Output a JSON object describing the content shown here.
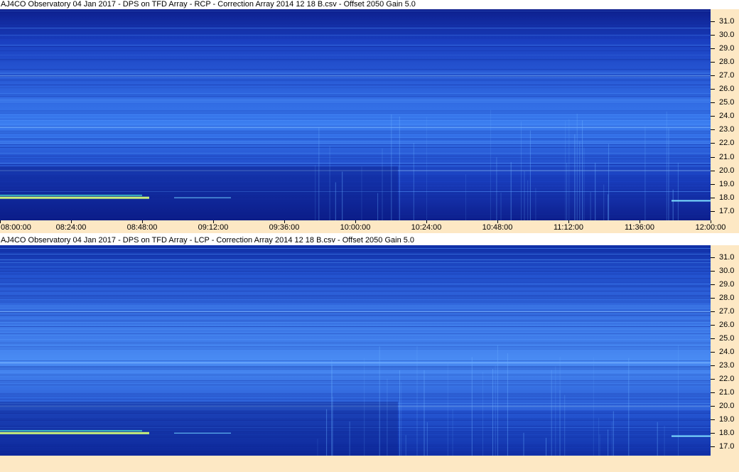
{
  "chart_data": [
    {
      "type": "heatmap",
      "title": "AJ4CO Observatory 04 Jan 2017  -  DPS on TFD Array  -  RCP  -  Correction Array 2014 12 18 B.csv  -  Offset 2050  Gain 5.0",
      "x_ticks": [
        "08:00:00",
        "08:24:00",
        "08:48:00",
        "09:12:00",
        "09:36:00",
        "10:00:00",
        "10:24:00",
        "10:48:00",
        "11:12:00",
        "11:36:00",
        "12:00:00"
      ],
      "y_ticks": [
        "17.0",
        "18.0",
        "19.0",
        "20.0",
        "21.0",
        "22.0",
        "23.0",
        "24.0",
        "25.0",
        "26.0",
        "27.0",
        "28.0",
        "29.0",
        "30.0",
        "31.0"
      ],
      "xlim": [
        "08:00:00",
        "12:00:00"
      ],
      "ylim": [
        16.3,
        31.9
      ],
      "colors": {
        "background": "#1a3fc0",
        "dark": "#0d1e8c",
        "bright": "#3a7cf0",
        "hot": "#c8f07a"
      }
    },
    {
      "type": "heatmap",
      "title": "AJ4CO Observatory 04 Jan 2017  -  DPS on TFD Array  -  LCP  -  Correction Array 2014 12 18 B.csv  -  Offset 2050  Gain 5.0",
      "x_ticks": [],
      "y_ticks": [
        "17.0",
        "18.0",
        "19.0",
        "20.0",
        "21.0",
        "22.0",
        "23.0",
        "24.0",
        "25.0",
        "26.0",
        "27.0",
        "28.0",
        "29.0",
        "30.0",
        "31.0"
      ],
      "xlim": [
        "08:00:00",
        "12:00:00"
      ],
      "ylim": [
        16.3,
        31.9
      ],
      "colors": {
        "background": "#2454d0",
        "dark": "#1030a8",
        "bright": "#4a8cf4",
        "hot": "#c8f07a"
      }
    }
  ]
}
